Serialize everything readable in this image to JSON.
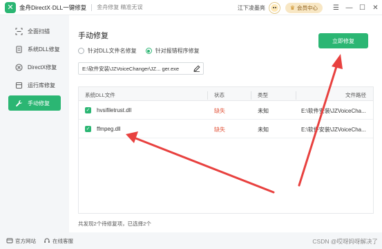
{
  "titlebar": {
    "app_title": "金舟DirectX·DLL一键修复",
    "subtitle": "金舟修复 精准无误",
    "username": "江下凌墨亮",
    "vip_label": "会员中心",
    "controls": {
      "menu": "☰",
      "minimize": "—",
      "maximize": "☐",
      "close": "✕"
    }
  },
  "sidebar": {
    "items": [
      {
        "label": "全面扫描",
        "icon": "scan-icon"
      },
      {
        "label": "系统DLL修复",
        "icon": "dll-file-icon"
      },
      {
        "label": "DirectX修复",
        "icon": "directx-icon"
      },
      {
        "label": "运行库修复",
        "icon": "runtime-library-icon"
      },
      {
        "label": "手动修复",
        "icon": "wrench-icon",
        "active": true
      }
    ]
  },
  "main": {
    "title": "手动修复",
    "radio_options": [
      {
        "label": "针对DLL文件名修复",
        "checked": false
      },
      {
        "label": "针对报错程序修复",
        "checked": true
      }
    ],
    "repair_button": "立即修复",
    "path_value": "E:\\软件安装\\JZVoiceChanger\\JZ... ger.exe",
    "table": {
      "headers": [
        "系统DLL文件",
        "状态",
        "类型",
        "文件路径"
      ],
      "rows": [
        {
          "file": "hvsifiletrust.dll",
          "status": "缺失",
          "type": "未知",
          "path": "E:\\软件安装\\JZVoiceCha..."
        },
        {
          "file": "ffmpeg.dll",
          "status": "缺失",
          "type": "未知",
          "path": "E:\\软件安装\\JZVoiceCha..."
        }
      ]
    },
    "summary": "共发现2个待修复项，已选择2个"
  },
  "bottombar": {
    "website": "官方网站",
    "support": "在线客服",
    "watermark": "CSDN @哎呀妈呀解决了"
  },
  "colors": {
    "accent": "#2bb673",
    "missing": "#e2553b",
    "annotation_arrow": "#e8413f"
  }
}
